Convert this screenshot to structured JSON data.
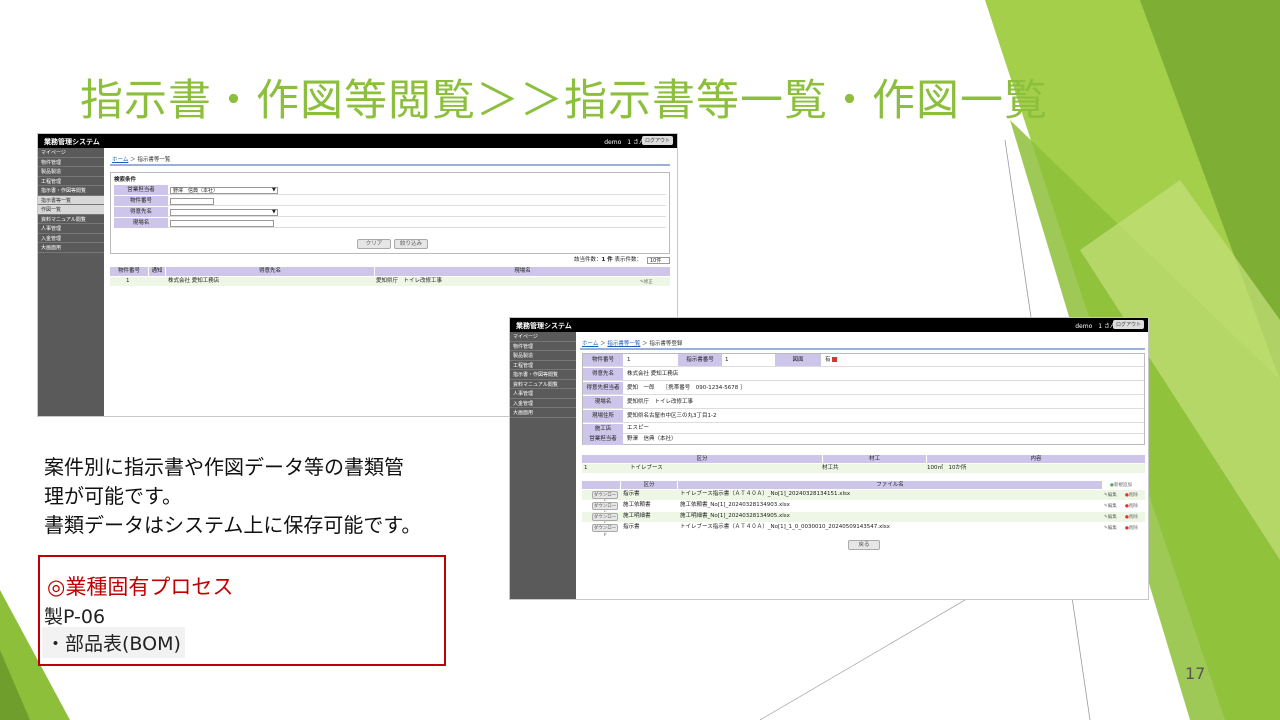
{
  "slide": {
    "title": "指示書・作図等閲覧＞＞指示書等一覧・作図一覧",
    "body_lines": [
      "案件別に指示書や作図データ等の書類管",
      "理が可能です。",
      "書類データはシステム上に保存可能です。"
    ],
    "process_heading": "◎業種固有プロセス",
    "process_code": "製P-06",
    "process_item": "・部品表(BOM)",
    "page_number": "17"
  },
  "app": {
    "name": "業務管理システム",
    "user": "demo　1 さん",
    "logout": "ログアウト",
    "sidebar": [
      "マイページ",
      "物件管理",
      "製品製造",
      "工程管理",
      "指示書・作図等閲覧",
      "指示書等一覧",
      "作図一覧",
      "資料マニュアル閲覧",
      "人事管理",
      "入金管理",
      "大画面用"
    ]
  },
  "list_screen": {
    "breadcrumb_home": "ホーム",
    "breadcrumb_sep": "＞",
    "breadcrumb_current": "指示書等一覧",
    "section_title": "検索条件",
    "fields": [
      {
        "label": "営業担当者",
        "value": "野澤　信典（本社）",
        "kind": "select"
      },
      {
        "label": "物件番号",
        "value": "",
        "kind": "text"
      },
      {
        "label": "得意先名",
        "value": "",
        "kind": "select"
      },
      {
        "label": "現場名",
        "value": "",
        "kind": "text"
      }
    ],
    "clear_button": "クリア",
    "filter_button": "絞り込み",
    "count_label": "該当件数：",
    "count_value": "1 件",
    "display_label": "表示件数：",
    "display_value": "10件",
    "columns": [
      "物件番号",
      "通知",
      "得意先名",
      "現場名"
    ],
    "rows": [
      {
        "no": "1",
        "notice": "",
        "customer": "株式会社 愛知工務店",
        "site": "愛知県庁　トイレ改修工事",
        "action": "修正"
      }
    ]
  },
  "detail_screen": {
    "breadcrumb_home": "ホーム",
    "breadcrumb_sep": "＞",
    "breadcrumb_mid": "指示書等一覧",
    "breadcrumb_current": "指示書等登録",
    "row1": {
      "label1": "物件番号",
      "value1": "1",
      "label2": "指示書番号",
      "value2": "1",
      "label3": "図面",
      "value3": "有"
    },
    "info": [
      {
        "label": "得意先名",
        "value": "株式会社 愛知工務店"
      },
      {
        "label": "得意先担当者",
        "value": "愛知　一郎　　［携帯番号　090-1234-5678 ］"
      },
      {
        "label": "現場名",
        "value": "愛知県庁　トイレ改修工事"
      },
      {
        "label": "現場住所",
        "value": "愛知県名古屋市中区三の丸3丁目1-2"
      },
      {
        "label": "施工店",
        "value": "エスピー"
      },
      {
        "label": "営業担当者",
        "value": "野澤　信典（本社）"
      }
    ],
    "parts_columns": [
      "区分",
      "材工",
      "内容"
    ],
    "parts_rows": [
      {
        "no": "1",
        "kubun": "トイレブース",
        "zaiko": "材工共",
        "content": "100㎡　10か所"
      }
    ],
    "files_columns": [
      "区分",
      "ファイル名"
    ],
    "add_label": "新規追加",
    "download_label": "ダウンロード",
    "edit_label": "編集",
    "delete_label": "削除",
    "files": [
      {
        "kubun": "指示書",
        "name": "トイレブース指示書（ＡＴ４０Ａ）_No[1]_20240328134151.xlsx"
      },
      {
        "kubun": "施工依頼書",
        "name": "施工依頼書_No[1]_20240328134903.xlsx"
      },
      {
        "kubun": "施工明細書",
        "name": "施工明細書_No[1]_20240328134905.xlsx"
      },
      {
        "kubun": "指示書",
        "name": "トイレブース指示書（ＡＴ４０Ａ）_No[1]_1_0_0030010_20240509143547.xlsx"
      }
    ],
    "back_button": "戻る"
  }
}
